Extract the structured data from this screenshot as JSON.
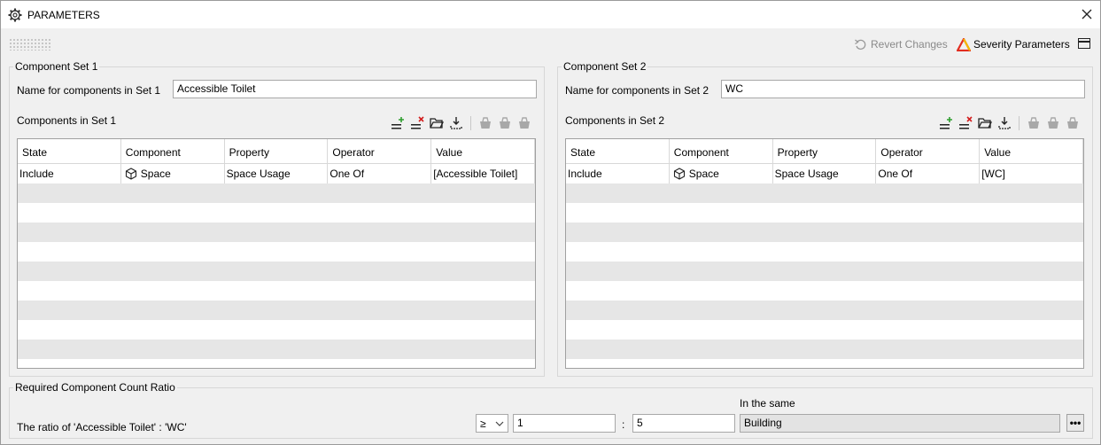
{
  "window": {
    "title": "PARAMETERS"
  },
  "toolbar": {
    "revert_label": "Revert Changes",
    "severity_label": "Severity Parameters"
  },
  "set1": {
    "legend": "Component Set 1",
    "name_label": "Name for components in Set 1",
    "name_value": "Accessible Toilet",
    "components_label": "Components in Set 1",
    "columns": [
      "State",
      "Component",
      "Property",
      "Operator",
      "Value"
    ],
    "rows": [
      {
        "state": "Include",
        "component": "Space",
        "property": "Space Usage",
        "operator": "One Of",
        "value": "[Accessible Toilet]"
      }
    ]
  },
  "set2": {
    "legend": "Component Set 2",
    "name_label": "Name for components in Set 2",
    "name_value": "WC",
    "components_label": "Components in Set 2",
    "columns": [
      "State",
      "Component",
      "Property",
      "Operator",
      "Value"
    ],
    "rows": [
      {
        "state": "Include",
        "component": "Space",
        "property": "Space Usage",
        "operator": "One Of",
        "value": "[WC]"
      }
    ]
  },
  "ratio": {
    "legend": "Required Component Count Ratio",
    "description": "The ratio of 'Accessible Toilet' : 'WC'",
    "operator": "≥",
    "left_value": "1",
    "separator": ":",
    "right_value": "5",
    "in_same_label": "In the same",
    "in_same_value": "Building",
    "browse_label": "•••"
  },
  "icons": [
    "settings-gear-icon",
    "close-icon",
    "undo-icon",
    "warning-triangle-icon",
    "panel-layout-icon",
    "add-row-icon",
    "remove-row-icon",
    "open-folder-icon",
    "download-icon",
    "basket-icon",
    "cube-icon",
    "chevron-down-icon"
  ],
  "colors": {
    "add_icon": "#2e9e2e",
    "remove_icon": "#d21f1f",
    "warning_red": "#e22d20",
    "warning_yellow": "#f5b800",
    "alt_row": "#e6e6e6"
  }
}
